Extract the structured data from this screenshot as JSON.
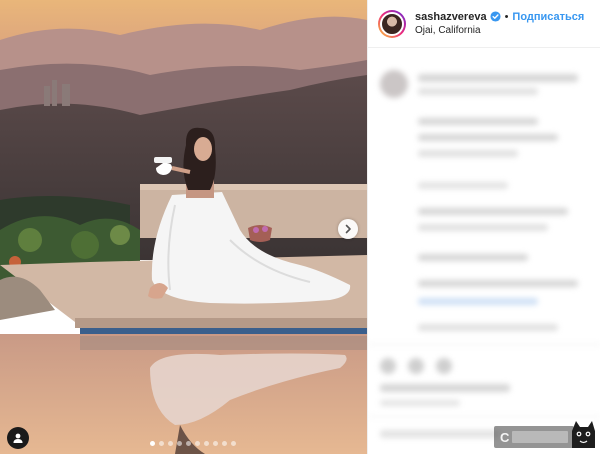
{
  "post": {
    "username": "sashazvereva",
    "separator": "•",
    "follow_label": "Подписаться",
    "location": "Ojai, California",
    "carousel": {
      "total": 10,
      "active_index": 0
    }
  },
  "icons": {
    "verified": "verified-badge-icon",
    "next": "chevron-right-icon",
    "tagged_user": "user-tag-icon"
  },
  "colors": {
    "follow_blue": "#3897f0",
    "verified_blue": "#3897f0",
    "text": "#262626"
  }
}
